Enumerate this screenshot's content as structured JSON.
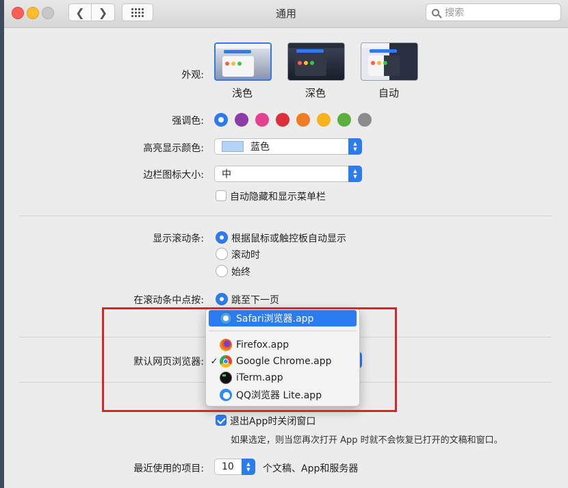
{
  "window": {
    "title": "通用"
  },
  "search": {
    "placeholder": "搜索"
  },
  "appearance": {
    "label": "外观:",
    "options": [
      {
        "label": "浅色",
        "selected": true
      },
      {
        "label": "深色",
        "selected": false
      },
      {
        "label": "自动",
        "selected": false
      }
    ]
  },
  "accent": {
    "label": "强调色:",
    "colors": [
      "#2d7bf0",
      "#8c3ba7",
      "#e6418f",
      "#dc2f3a",
      "#f07c25",
      "#f6b31e",
      "#5ab03f",
      "#8c8c8c"
    ],
    "selected_index": 0
  },
  "highlight": {
    "label": "高亮显示颜色:",
    "value": "蓝色"
  },
  "sidebar_icon": {
    "label": "边栏图标大小:",
    "value": "中"
  },
  "menubar_autohide": {
    "label": "自动隐藏和显示菜单栏",
    "checked": false
  },
  "scrollbars": {
    "label": "显示滚动条:",
    "options": [
      {
        "label": "根据鼠标或触控板自动显示",
        "selected": true
      },
      {
        "label": "滚动时",
        "selected": false
      },
      {
        "label": "始终",
        "selected": false
      }
    ]
  },
  "click_scroll": {
    "label": "在滚动条中点按:",
    "option": "跳至下一页"
  },
  "default_browser": {
    "label": "默认网页浏览器:",
    "menu": [
      {
        "label": "Safari浏览器.app",
        "icon": "safari-icon",
        "highlighted": true,
        "checked": false
      },
      {
        "label": "Firefox.app",
        "icon": "firefox-icon",
        "highlighted": false,
        "checked": false
      },
      {
        "label": "Google Chrome.app",
        "icon": "chrome-icon",
        "highlighted": false,
        "checked": true
      },
      {
        "label": "iTerm.app",
        "icon": "iterm-icon",
        "highlighted": false,
        "checked": false
      },
      {
        "label": "QQ浏览器 Lite.app",
        "icon": "qq-browser-icon",
        "highlighted": false,
        "checked": false
      }
    ],
    "checkmark": "✓"
  },
  "close_windows": {
    "label": "退出App时关闭窗口",
    "checked": true,
    "description": "如果选定，则当您再次打开 App 时就不会恢复已打开的文稿和窗口。"
  },
  "recent_items": {
    "label": "最近使用的项目:",
    "value": "10",
    "suffix": "个文稿、App和服务器"
  }
}
